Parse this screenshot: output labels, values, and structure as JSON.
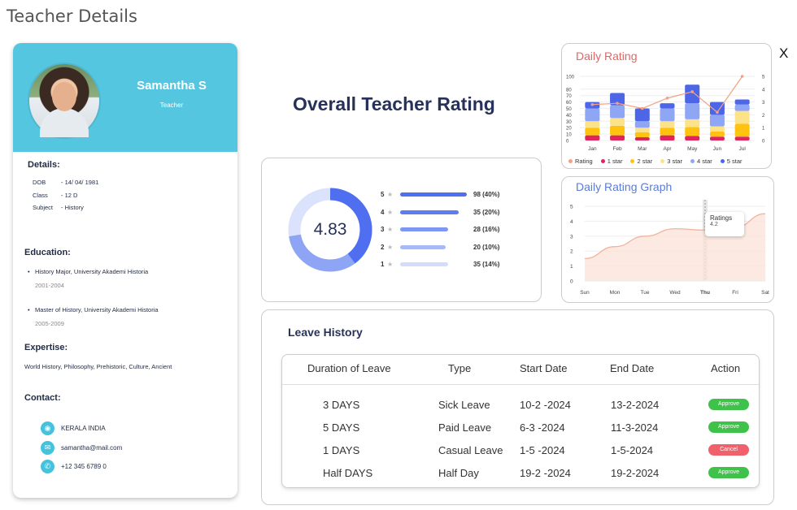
{
  "page": {
    "title": "Teacher Details",
    "close": "X"
  },
  "profile": {
    "name": "Samantha S",
    "role": "Teacher",
    "details_title": "Details:",
    "details": [
      {
        "label": "DOB",
        "value": "- 14/ 04/ 1981"
      },
      {
        "label": "Class",
        "value": "- 12 D"
      },
      {
        "label": "Subject",
        "value": "- History"
      }
    ],
    "education_title": "Education:",
    "education": [
      {
        "degree": "History Major, University Akademi Historia",
        "years": "2001-2004"
      },
      {
        "degree": "Master of History, University Akademi Historia",
        "years": "2005-2009"
      }
    ],
    "expertise_title": "Expertise:",
    "expertise": "World History, Philosophy, Prehistoric, Culture, Ancient",
    "contact_title": "Contact:",
    "contacts": [
      {
        "icon": "location-icon",
        "text": "KERALA INDIA"
      },
      {
        "icon": "mail-icon",
        "text": "samantha@mail.com"
      },
      {
        "icon": "phone-icon",
        "text": "+12 345 6789 0"
      }
    ]
  },
  "overall": {
    "title": "Overall Teacher Rating",
    "score": "4.83",
    "breakdown": [
      {
        "stars": "5",
        "count": "98 (40%)",
        "fraction": 1.0,
        "color": "#4f6ff0"
      },
      {
        "stars": "4",
        "count": "35 (20%)",
        "fraction": 0.88,
        "color": "#5d7cf2"
      },
      {
        "stars": "3",
        "count": "28 (16%)",
        "fraction": 0.72,
        "color": "#7e96f4"
      },
      {
        "stars": "2",
        "count": "20 (10%)",
        "fraction": 0.68,
        "color": "#a9b9f7"
      },
      {
        "stars": "1",
        "count": "35 (14%)",
        "fraction": 0.72,
        "color": "#d3dcfb"
      }
    ]
  },
  "daily_rating": {
    "title": "Daily Rating",
    "title_color": "#e06666",
    "chart_data": {
      "type": "bar",
      "categories": [
        "Jan",
        "Feb",
        "Mar",
        "Apr",
        "May",
        "Jun",
        "Jul"
      ],
      "ylim": [
        0,
        100
      ],
      "y2lim": [
        0,
        5
      ],
      "yticks": [
        "0",
        "10",
        "20",
        "30",
        "40",
        "50",
        "60",
        "70",
        "80",
        "100"
      ],
      "y2ticks": [
        "0",
        "1",
        "2",
        "3",
        "4",
        "5"
      ],
      "series": [
        {
          "name": "1 star",
          "color": "#e0245e",
          "values": [
            8,
            8,
            5,
            8,
            7,
            6,
            6
          ]
        },
        {
          "name": "2 star",
          "color": "#ffc20e",
          "values": [
            12,
            15,
            8,
            12,
            14,
            8,
            20
          ]
        },
        {
          "name": "3 star",
          "color": "#fce38a",
          "values": [
            10,
            12,
            7,
            10,
            12,
            8,
            20
          ]
        },
        {
          "name": "4 star",
          "color": "#8fa6f5",
          "values": [
            20,
            20,
            10,
            20,
            25,
            18,
            10
          ]
        },
        {
          "name": "5 star",
          "color": "#4d66e8",
          "values": [
            10,
            19,
            20,
            8,
            29,
            20,
            8
          ]
        }
      ],
      "line": {
        "name": "Rating",
        "color": "#f4a084",
        "values": [
          2.8,
          2.9,
          2.5,
          3.3,
          3.8,
          2.2,
          5.0
        ]
      }
    }
  },
  "daily_graph": {
    "title": "Daily Rating Graph",
    "title_color": "#5b7bd5",
    "tooltip_title": "Ratings",
    "tooltip_value": "4.2",
    "chart_data": {
      "type": "area",
      "x": [
        "Sun",
        "Mon",
        "Tue",
        "Wed",
        "Thu",
        "Fri",
        "Sat"
      ],
      "values": [
        1.5,
        2.3,
        3.0,
        3.5,
        3.4,
        3.6,
        4.5
      ],
      "ylim": [
        0,
        5
      ],
      "yticks": [
        "0",
        "1",
        "2",
        "3",
        "4",
        "5"
      ],
      "highlight": "Thu",
      "color": "#f2b39c"
    }
  },
  "leave": {
    "title": "Leave History",
    "headers": [
      "Duration of Leave",
      "Type",
      "Start Date",
      "End Date",
      "Action"
    ],
    "rows": [
      {
        "duration": "3 DAYS",
        "type": "Sick Leave",
        "start": "10-2 -2024",
        "end": "13-2-2024",
        "action": "Approve",
        "color": "#3ec24a"
      },
      {
        "duration": "5 DAYS",
        "type": "Paid Leave",
        "start": "6-3 -2024",
        "end": "11-3-2024",
        "action": "Approve",
        "color": "#3ec24a"
      },
      {
        "duration": "1 DAYS",
        "type": "Casual Leave",
        "start": "1-5 -2024",
        "end": "1-5-2024",
        "action": "Cancel",
        "color": "#f0616b"
      },
      {
        "duration": "Half DAYS",
        "type": "Half Day",
        "start": "19-2 -2024",
        "end": "19-2-2024",
        "action": "Approve",
        "color": "#3ec24a"
      }
    ]
  }
}
